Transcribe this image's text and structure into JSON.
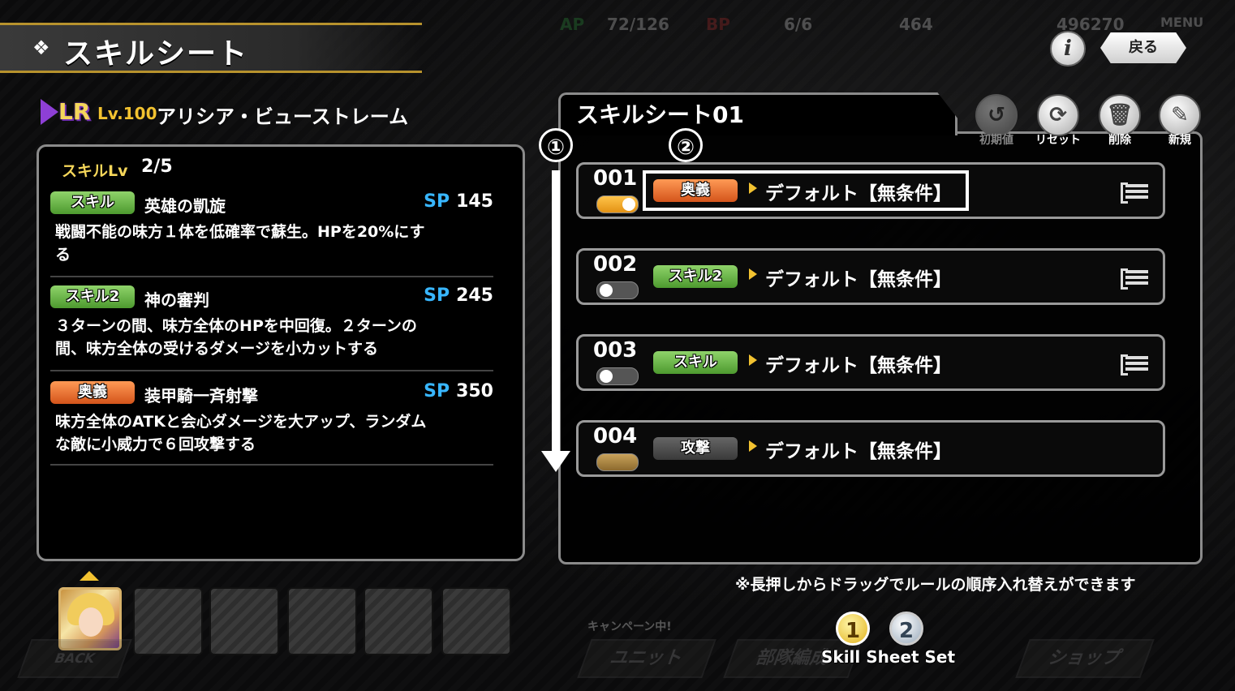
{
  "status_bar": {
    "ap_label": "AP",
    "ap_value": "72/126",
    "bp_label": "BP",
    "bp_value": "6/6",
    "gems": "464",
    "coins": "496270",
    "menu": "MENU"
  },
  "header": {
    "title": "スキルシート",
    "info_icon": "i",
    "back_label": "戻る"
  },
  "character": {
    "rarity": "LR",
    "level": "Lv.100",
    "name": "アリシア・ビューストレーム"
  },
  "skill_panel": {
    "skilllv_label": "スキルLv",
    "skilllv_value": "2/5",
    "sp_label": "SP",
    "skills": [
      {
        "tag": "スキル",
        "name": "英雄の凱旋",
        "sp": "145",
        "desc_line1": "戦闘不能の味方１体を低確率で蘇生。HPを20%にす",
        "desc_line2": "る"
      },
      {
        "tag": "スキル2",
        "name": "神の審判",
        "sp": "245",
        "desc_line1": "３ターンの間、味方全体のHPを中回復。２ターンの",
        "desc_line2": "間、味方全体の受けるダメージを小カットする"
      },
      {
        "tag": "奥義",
        "name": "装甲騎一斉射撃",
        "sp": "350",
        "desc_line1": "味方全体のATKと会心ダメージを大アップ、ランダム",
        "desc_line2": "な敵に小威力で６回攻撃する"
      }
    ]
  },
  "sheet": {
    "title": "スキルシート01",
    "controls": [
      {
        "label": "初期値",
        "icon": "clock-reset-icon",
        "glyph": "↺"
      },
      {
        "label": "リセット",
        "icon": "refresh-icon",
        "glyph": "⟳"
      },
      {
        "label": "削除",
        "icon": "trash-icon",
        "glyph": "🗑"
      },
      {
        "label": "新規",
        "icon": "pencil-icon",
        "glyph": "✎"
      }
    ],
    "rules": [
      {
        "num": "001",
        "toggle": "on",
        "tag": "奥義",
        "tag_color": "orange",
        "condition": "デフォルト【無条件】"
      },
      {
        "num": "002",
        "toggle": "off",
        "tag": "スキル2",
        "tag_color": "green",
        "condition": "デフォルト【無条件】"
      },
      {
        "num": "003",
        "toggle": "off",
        "tag": "スキル",
        "tag_color": "green",
        "condition": "デフォルト【無条件】"
      },
      {
        "num": "004",
        "toggle": "gold",
        "tag": "攻撃",
        "tag_color": "gray",
        "condition": "デフォルト【無条件】"
      }
    ],
    "note": "※長押しからドラッグでルールの順序入れ替えができます"
  },
  "annotations": {
    "marker1": "①",
    "marker2": "②"
  },
  "pager": {
    "pages": [
      "1",
      "2"
    ],
    "active": "1",
    "label": "Skill Sheet Set"
  },
  "bottom_nav": {
    "campaign": "キャンペーン中!",
    "back": "BACK",
    "items": [
      "ユニット",
      "部隊編成",
      "ショップ"
    ]
  },
  "colors": {
    "accent_gold": "#b7922d",
    "sp_blue": "#38b6ff",
    "tag_green": "#4d9a2f",
    "tag_orange": "#d4541b"
  }
}
